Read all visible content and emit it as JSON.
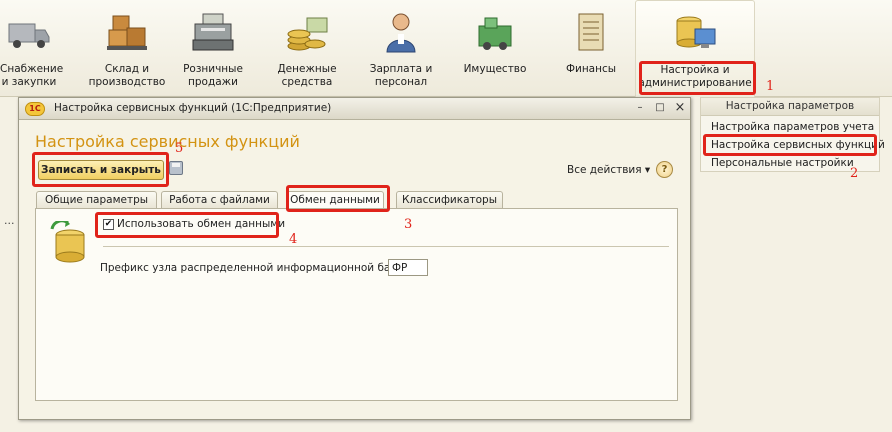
{
  "sections": [
    {
      "id": "supply",
      "label": "Снабжение\nи закупки"
    },
    {
      "id": "warehouse",
      "label": "Склад и\nпроизводство"
    },
    {
      "id": "retail",
      "label": "Розничные\nпродажи"
    },
    {
      "id": "money",
      "label": "Денежные\nсредства"
    },
    {
      "id": "salary",
      "label": "Зарплата и\nперсонал"
    },
    {
      "id": "property",
      "label": "Имущество"
    },
    {
      "id": "finance",
      "label": "Финансы"
    },
    {
      "id": "admin",
      "label": "Настройка и\nадминистрирование"
    }
  ],
  "annotations": {
    "n1": "1",
    "n2": "2",
    "n3": "3",
    "n4": "4",
    "n5": "5"
  },
  "right_panel": {
    "title": "Настройка параметров",
    "items": [
      "Настройка параметров учета",
      "Настройка сервисных функций",
      "Персональные настройки"
    ]
  },
  "window": {
    "logo": "1С",
    "title": "Настройка сервисных функций  (1С:Предприятие)",
    "buttons": {
      "min": "–",
      "max": "□",
      "close": "×"
    },
    "form_title": "Настройка сервисных функций",
    "save_close": "Записать и закрыть",
    "all_actions": "Все действия ▾",
    "help": "?",
    "tabs": [
      "Общие параметры",
      "Работа с файлами",
      "Обмен данными",
      "Классификаторы"
    ],
    "checkbox": {
      "label": "Использовать обмен данными",
      "checked": true,
      "mark": "✔"
    },
    "prefix_label": "Префикс узла распределенной информационной базы:",
    "prefix_value": "ФР"
  },
  "left_dots": "...",
  "colors": {
    "accent_red": "#e0231a",
    "form_title": "#d39313",
    "button": "#f1cf61"
  }
}
